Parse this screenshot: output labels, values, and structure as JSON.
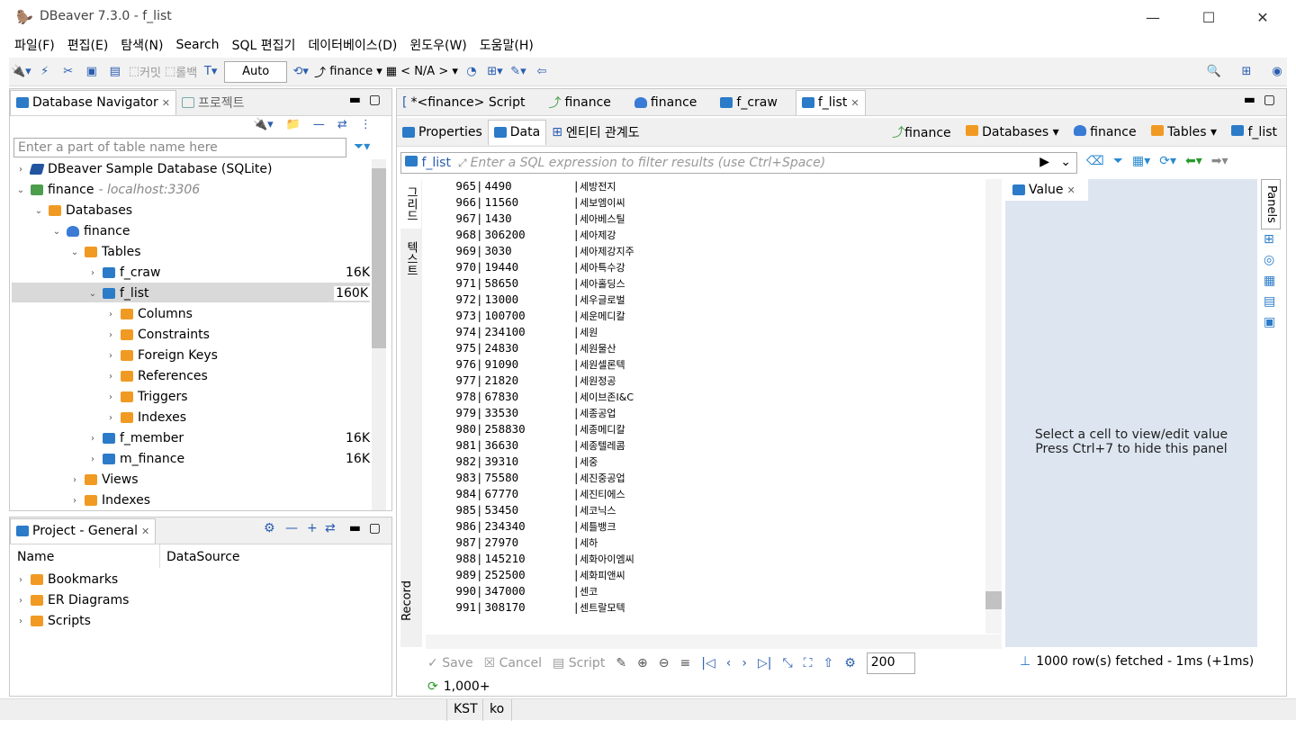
{
  "window": {
    "title": "DBeaver 7.3.0 - f_list"
  },
  "menu": [
    "파일(F)",
    "편집(E)",
    "탐색(N)",
    "Search",
    "SQL 편집기",
    "데이터베이스(D)",
    "윈도우(W)",
    "도움말(H)"
  ],
  "toolbar": {
    "commit": "커밋",
    "rollback": "롤백",
    "mode": "Auto",
    "connection": "finance",
    "schema": "< N/A >"
  },
  "navigator": {
    "tab": "Database Navigator",
    "tab2": "프로젝트",
    "filter_placeholder": "Enter a part of table name here",
    "items": [
      {
        "label": "DBeaver Sample Database (SQLite)"
      },
      {
        "label": "finance",
        "host": "- localhost:3306"
      },
      {
        "label": "Databases"
      },
      {
        "label": "finance"
      },
      {
        "label": "Tables"
      },
      {
        "label": "f_craw",
        "size": "16K"
      },
      {
        "label": "f_list",
        "size": "160K"
      },
      {
        "label": "Columns"
      },
      {
        "label": "Constraints"
      },
      {
        "label": "Foreign Keys"
      },
      {
        "label": "References"
      },
      {
        "label": "Triggers"
      },
      {
        "label": "Indexes"
      },
      {
        "label": "f_member",
        "size": "16K"
      },
      {
        "label": "m_finance",
        "size": "16K"
      },
      {
        "label": "Views"
      },
      {
        "label": "Indexes"
      }
    ]
  },
  "project": {
    "tab": "Project - General",
    "col_name": "Name",
    "col_ds": "DataSource",
    "items": [
      "Bookmarks",
      "ER Diagrams",
      "Scripts"
    ]
  },
  "editor_tabs": [
    "*<finance> Script",
    "finance",
    "finance",
    "f_craw",
    "f_list"
  ],
  "sub_tabs": {
    "properties": "Properties",
    "data": "Data",
    "er": "엔티티 관계도"
  },
  "breadcrumb": [
    "finance",
    "Databases",
    "finance",
    "Tables",
    "f_list"
  ],
  "filter": {
    "table": "f_list",
    "placeholder": "Enter a SQL expression to filter results (use Ctrl+Space)"
  },
  "side_tabs": {
    "grid": "그리드",
    "text": "텍스트",
    "record": "Record"
  },
  "rows": [
    {
      "n": "965",
      "v": "4490",
      "t": "세방전지"
    },
    {
      "n": "966",
      "v": "11560",
      "t": "세보엠이씨"
    },
    {
      "n": "967",
      "v": "1430",
      "t": "세아베스틸"
    },
    {
      "n": "968",
      "v": "306200",
      "t": "세아제강"
    },
    {
      "n": "969",
      "v": "3030",
      "t": "세아제강지주"
    },
    {
      "n": "970",
      "v": "19440",
      "t": "세아특수강"
    },
    {
      "n": "971",
      "v": "58650",
      "t": "세아홀딩스"
    },
    {
      "n": "972",
      "v": "13000",
      "t": "세우글로벌"
    },
    {
      "n": "973",
      "v": "100700",
      "t": "세운메디칼"
    },
    {
      "n": "974",
      "v": "234100",
      "t": "세원"
    },
    {
      "n": "975",
      "v": "24830",
      "t": "세원물산"
    },
    {
      "n": "976",
      "v": "91090",
      "t": "세원셀론텍"
    },
    {
      "n": "977",
      "v": "21820",
      "t": "세원정공"
    },
    {
      "n": "978",
      "v": "67830",
      "t": "세이브존I&C"
    },
    {
      "n": "979",
      "v": "33530",
      "t": "세종공업"
    },
    {
      "n": "980",
      "v": "258830",
      "t": "세종메디칼"
    },
    {
      "n": "981",
      "v": "36630",
      "t": "세종텔레콤"
    },
    {
      "n": "982",
      "v": "39310",
      "t": "세중"
    },
    {
      "n": "983",
      "v": "75580",
      "t": "세진중공업"
    },
    {
      "n": "984",
      "v": "67770",
      "t": "세진티에스"
    },
    {
      "n": "985",
      "v": "53450",
      "t": "세코닉스"
    },
    {
      "n": "986",
      "v": "234340",
      "t": "세틀뱅크"
    },
    {
      "n": "987",
      "v": "27970",
      "t": "세하"
    },
    {
      "n": "988",
      "v": "145210",
      "t": "세화아이엠씨"
    },
    {
      "n": "989",
      "v": "252500",
      "t": "세화피앤씨"
    },
    {
      "n": "990",
      "v": "347000",
      "t": "센코"
    },
    {
      "n": "991",
      "v": "308170",
      "t": "센트랄모텍"
    }
  ],
  "value_panel": {
    "tab": "Value",
    "msg1": "Select a cell to view/edit value",
    "msg2": "Press Ctrl+7 to hide this panel",
    "panels": "Panels"
  },
  "bottom": {
    "save": "Save",
    "cancel": "Cancel",
    "script": "Script",
    "limit": "200",
    "fetched": "1000 row(s) fetched - 1ms (+1ms)",
    "count": "1,000+"
  },
  "status": {
    "tz": "KST",
    "locale": "ko"
  }
}
